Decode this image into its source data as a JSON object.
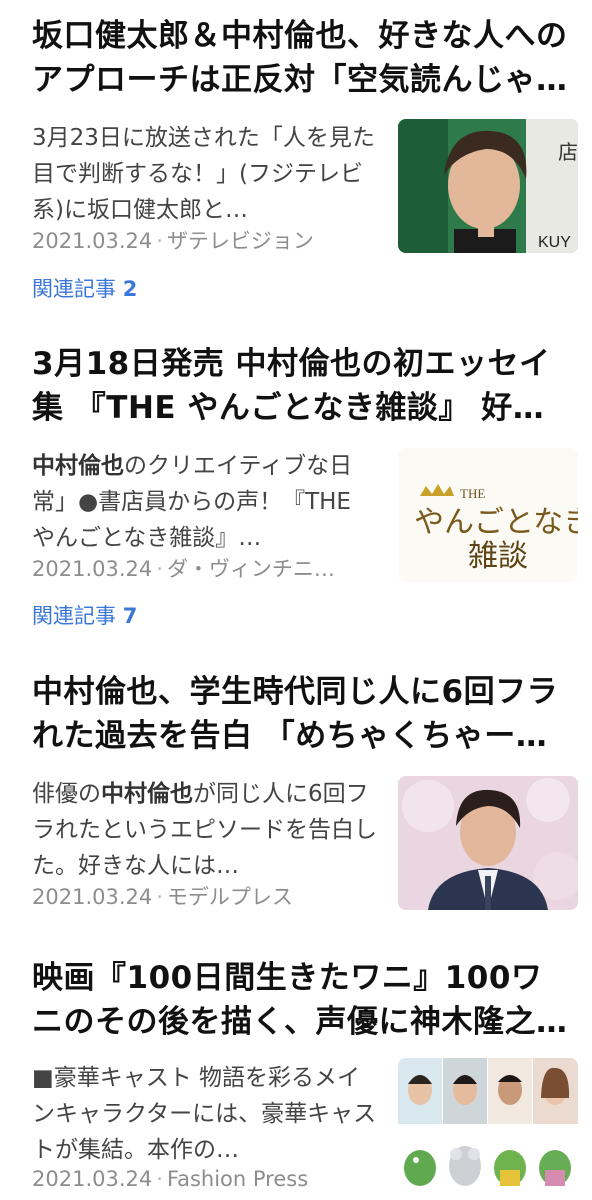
{
  "articles": [
    {
      "title": "坂口健太郎＆中村倫也、好きな人へのアプローチは正反対「空気読んじゃうタイプ」",
      "snippet_pre": "",
      "snippet_bold": "",
      "snippet_post": "3月23日に放送された「人を見た目で判断するな！」(フジテレビ系)に坂口健太郎と…",
      "date": "2021.03.24",
      "source": "ザテレビジョン",
      "related_label": "関連記事",
      "related_count": "2",
      "thumb_icon": "portrait-photo-icon"
    },
    {
      "title": "3月18日発売 中村倫也の初エッセイ集 『THE やんごとなき雑談』 好評…",
      "snippet_pre": "",
      "snippet_bold": "中村倫也",
      "snippet_post": "のクリエイティブな日常」●書店員からの声！『THE やんごとなき雑談』…",
      "date": "2021.03.24",
      "source": "ダ・ヴィンチニ…",
      "related_label": "関連記事",
      "related_count": "7",
      "thumb_icon": "book-title-logo-icon",
      "thumb_logo_small": "THE",
      "thumb_logo_line1": "やんごとなき",
      "thumb_logo_line2": "雑談"
    },
    {
      "title": "中村倫也、学生時代同じ人に6回フラれた過去を告白 「めちゃくちゃー…",
      "snippet_pre": "俳優の",
      "snippet_bold": "中村倫也",
      "snippet_post": "が同じ人に6回フラれたというエピソードを告白した。好きな人には…",
      "date": "2021.03.24",
      "source": "モデルプレス",
      "thumb_icon": "portrait-photo-icon"
    },
    {
      "title": "映画『100日間生きたワニ』100ワニのその後を描く、声優に神木隆之介…",
      "snippet_pre": "■豪華キャスト 物語を彩るメインキャラクターには、豪華キャストが集結。本作の…",
      "snippet_bold": "",
      "snippet_post": "",
      "date": "2021.03.24",
      "source": "Fashion Press",
      "thumb_icon": "cast-collage-icon"
    }
  ],
  "colors": {
    "link": "#3b77d8",
    "meta": "#8d8d8d",
    "title": "#111111"
  }
}
